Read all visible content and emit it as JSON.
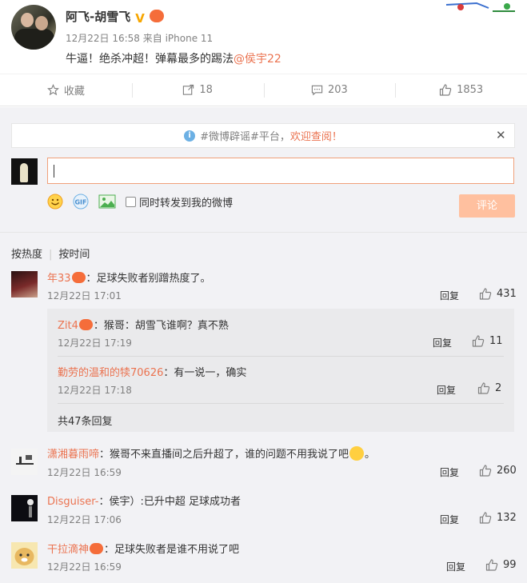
{
  "post": {
    "author": "阿飞-胡雪飞",
    "meta": "12月22日 16:58 来自 iPhone 11",
    "text": "牛逼！绝杀冲超！弹幕最多的踢法",
    "mention": "@侯宇22"
  },
  "actions": {
    "favorite": "收藏",
    "repost": "18",
    "comment": "203",
    "like": "1853"
  },
  "notice": {
    "text_tag": "#微博辟谣#平台，",
    "text_link": "欢迎查阅！"
  },
  "composer": {
    "repost_option": "同时转发到我的微博",
    "submit": "评论",
    "icons": [
      "emoji-icon",
      "gif-icon",
      "image-icon"
    ]
  },
  "sort": {
    "hot": "按热度",
    "time": "按时间"
  },
  "reply_label": "回复",
  "comments": [
    {
      "name": "年33",
      "text": "：足球失败者别蹭热度了。",
      "time": "12月22日 17:01",
      "likes": "431"
    },
    {
      "name": "潇湘暮雨啼",
      "text": "：猴哥不来直播间之后升超了，谁的问题不用我说了吧",
      "text_end": "。",
      "time": "12月22日 16:59",
      "likes": "260"
    },
    {
      "name": "Disguiser-",
      "text": "：侯宇）:已升中超  足球成功者",
      "time": "12月22日 17:06",
      "likes": "132"
    },
    {
      "name": "干拉滴神",
      "text": "：足球失败者是谁不用说了吧",
      "time": "12月22日 16:59",
      "likes": "99"
    }
  ],
  "sub_comments": [
    {
      "name": "Zit4",
      "text": "：猴哥：胡雪飞谁啊？真不熟",
      "time": "12月22日 17:19",
      "likes": "11"
    },
    {
      "name": "勤劳的温和的犊70626",
      "text": "：有一说一，确实",
      "time": "12月22日 17:18",
      "likes": "2"
    }
  ],
  "more_replies": "共47条回复",
  "colors": {
    "accent": "#eb7350",
    "button": "#ffc09f",
    "background": "#f2f2f5"
  }
}
